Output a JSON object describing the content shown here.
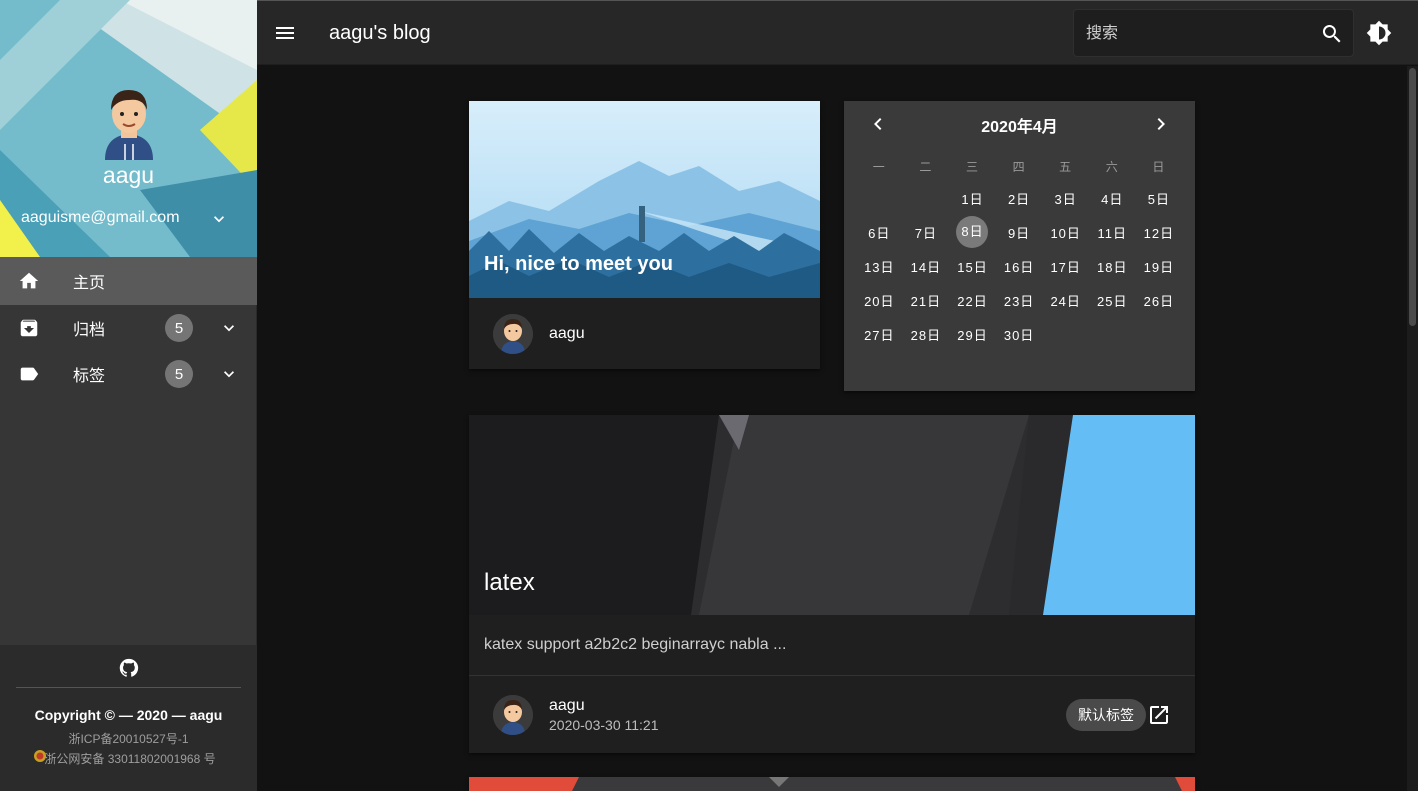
{
  "sidebar": {
    "profile": {
      "name": "aagu",
      "email": "aaguisme@gmail.com"
    },
    "nav": [
      {
        "label": "主页",
        "icon": "home-icon",
        "active": true
      },
      {
        "label": "归档",
        "icon": "archive-icon",
        "badge": "5"
      },
      {
        "label": "标签",
        "icon": "tag-icon",
        "badge": "5"
      }
    ],
    "footer": {
      "copyright_prefix": "Copyright © — 2020 — ",
      "copyright_owner": "aagu",
      "icp": "浙ICP备20010527号-1",
      "gongan": "浙公网安备 33011802001968 号"
    }
  },
  "appbar": {
    "title": "aagu's blog",
    "search_placeholder": "搜索"
  },
  "welcome_card": {
    "greeting": "Hi, nice to meet you",
    "author": "aagu"
  },
  "calendar": {
    "month_label": "2020年4月",
    "weekdays": [
      "一",
      "二",
      "三",
      "四",
      "五",
      "六",
      "日"
    ],
    "weeks": [
      [
        "",
        "",
        "1日",
        "2日",
        "3日",
        "4日",
        "5日"
      ],
      [
        "6日",
        "7日",
        "8日",
        "9日",
        "10日",
        "11日",
        "12日"
      ],
      [
        "13日",
        "14日",
        "15日",
        "16日",
        "17日",
        "18日",
        "19日"
      ],
      [
        "20日",
        "21日",
        "22日",
        "23日",
        "24日",
        "25日",
        "26日"
      ],
      [
        "27日",
        "28日",
        "29日",
        "30日",
        "",
        "",
        ""
      ]
    ],
    "today": "8日"
  },
  "post": {
    "title": "latex",
    "excerpt": "katex support a2b2c2 beginarrayc nabla ...",
    "author": "aagu",
    "date": "2020-03-30 11:21",
    "tag": "默认标签"
  },
  "colors": {
    "accent_blue": "#64bef5",
    "appbar": "#272727",
    "sidebar": "#363636"
  }
}
